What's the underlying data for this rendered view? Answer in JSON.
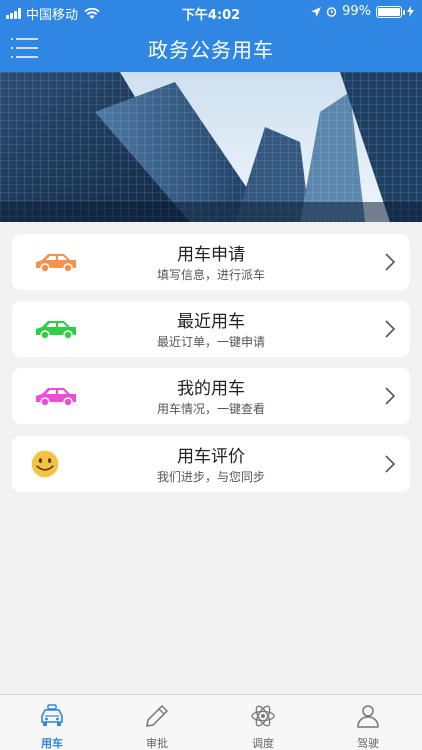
{
  "status_bar": {
    "carrier": "中国移动",
    "time": "下午4:02",
    "battery": "99%",
    "battery_level": 0.99
  },
  "nav": {
    "title": "政务公务用车",
    "menu_icon": "menu-icon"
  },
  "banner": {
    "image": "city-skyscrapers-banner"
  },
  "cards": [
    {
      "title": "用车申请",
      "subtitle": "填写信息，进行派车",
      "icon": "car-icon",
      "icon_color": "#f5924e"
    },
    {
      "title": "最近用车",
      "subtitle": "最近订单，一键申请",
      "icon": "car-icon",
      "icon_color": "#2ecf45"
    },
    {
      "title": "我的用车",
      "subtitle": "用车情况，一键查看",
      "icon": "car-icon",
      "icon_color": "#f04bd8"
    },
    {
      "title": "用车评价",
      "subtitle": "我们进步，与您同步",
      "icon": "smiley-icon",
      "icon_color": "#f4c343"
    }
  ],
  "tabs": [
    {
      "label": "用车",
      "icon": "taxi-icon",
      "active": true
    },
    {
      "label": "审批",
      "icon": "pencil-icon",
      "active": false
    },
    {
      "label": "调度",
      "icon": "atom-icon",
      "active": false
    },
    {
      "label": "驾驶",
      "icon": "person-icon",
      "active": false
    }
  ],
  "colors": {
    "primary": "#2f86e3",
    "background": "#f2f2f2",
    "card": "#ffffff",
    "tab_inactive": "#666666"
  }
}
